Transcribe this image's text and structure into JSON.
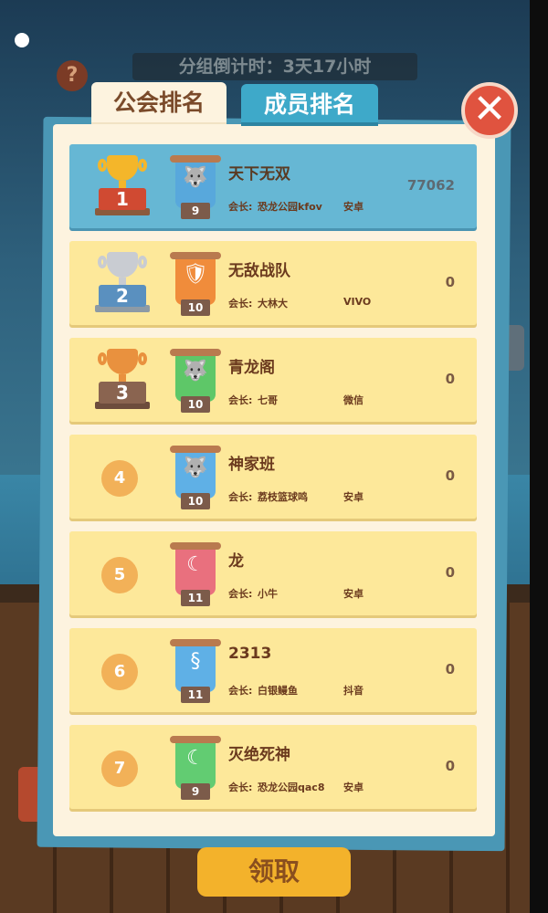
{
  "header": {
    "countdown": "分组倒计时：3天17小时",
    "help_icon": "?"
  },
  "tabs": [
    {
      "label": "公会排名",
      "active": true
    },
    {
      "label": "成员排名",
      "active": false
    }
  ],
  "close_icon": "✕",
  "leader_label": "会长:",
  "guilds": [
    {
      "rank": "1",
      "name": "天下无双",
      "level": "9",
      "leader": "恐龙公园kfov",
      "platform": "安卓",
      "score": "77062",
      "emblem": "wolf-icon"
    },
    {
      "rank": "2",
      "name": "无敌战队",
      "level": "10",
      "leader": "大林大",
      "platform": "VIVO",
      "score": "0",
      "emblem": "shield-icon"
    },
    {
      "rank": "3",
      "name": "青龙阁",
      "level": "10",
      "leader": "七哥",
      "platform": "微信",
      "score": "0",
      "emblem": "wolf-icon"
    },
    {
      "rank": "4",
      "name": "神家班",
      "level": "10",
      "leader": "荔枝篮球鸣",
      "platform": "安卓",
      "score": "0",
      "emblem": "wolf-icon"
    },
    {
      "rank": "5",
      "name": "龙",
      "level": "11",
      "leader": "小牛",
      "platform": "安卓",
      "score": "0",
      "emblem": "moon-icon"
    },
    {
      "rank": "6",
      "name": "2313",
      "level": "11",
      "leader": "白银鳗鱼",
      "platform": "抖音",
      "score": "0",
      "emblem": "seahorse-icon"
    },
    {
      "rank": "7",
      "name": "灭绝死神",
      "level": "9",
      "leader": "恐龙公园qac8",
      "platform": "安卓",
      "score": "0",
      "emblem": "moon-icon"
    }
  ],
  "claim_button": "领取",
  "colors": {
    "panel": "#fdf3df",
    "row": "#fde89a",
    "first_row": "#66b7d4",
    "tab_active_text": "#7a4a2a",
    "claim": "#f3b22b",
    "close": "#e0533f"
  }
}
